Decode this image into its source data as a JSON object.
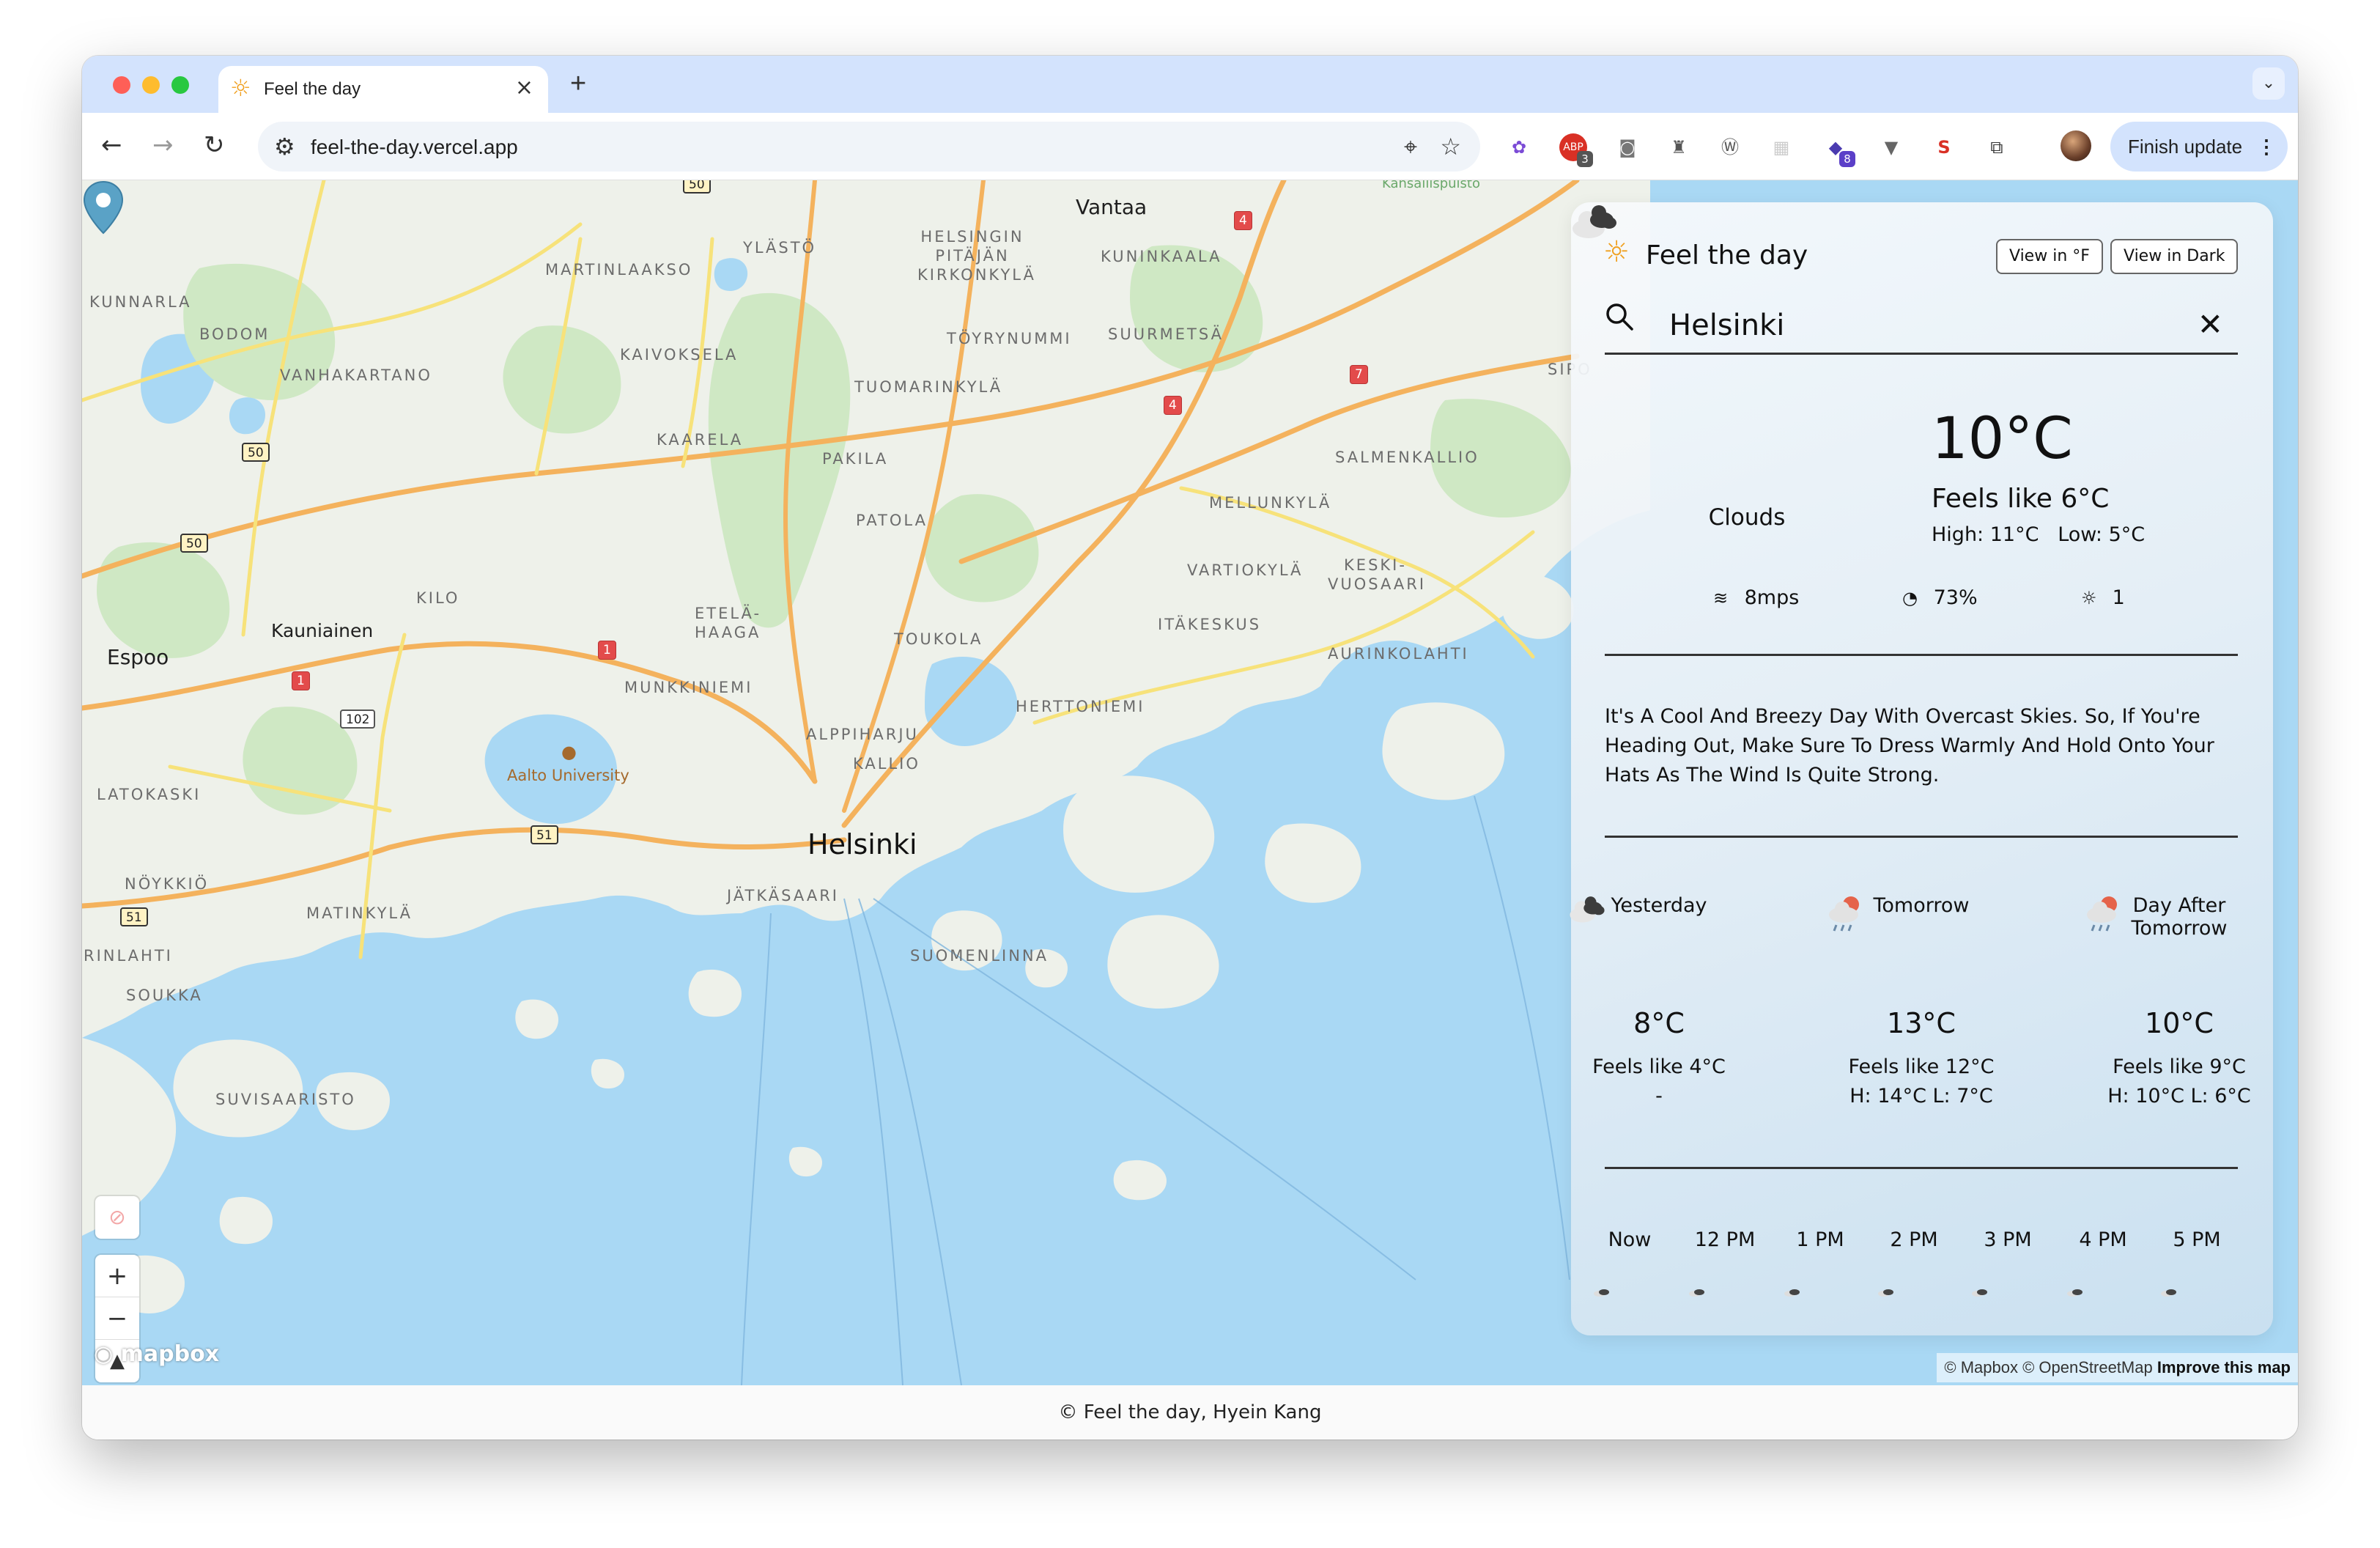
{
  "browser": {
    "tab_title": "Feel the day",
    "tab_icon": "sun-icon",
    "url": "feel-the-day.vercel.app",
    "extension_badges": [
      "3",
      "8"
    ],
    "finish_update_label": "Finish update"
  },
  "map": {
    "labels": {
      "vantaa": "Vantaa",
      "ylasto": "YLÄSTÖ",
      "helsingin_pitajan_kirkonkyla": "HELSINGIN PITÄJÄN KIRKONKYLÄ",
      "kuninkaala": "KUNINKAALA",
      "martinlaakso": "MARTINLAAKSO",
      "kunnarla": "KUNNARLA",
      "bodom": "BODOM",
      "vanhakartano": "VANHAKARTANO",
      "kaivoksela": "KAIVOKSELA",
      "toyrynummi": "TÖYRYNUMMI",
      "suurmetsa": "SUURMETSÄ",
      "tuomarinkyla": "TUOMARINKYLÄ",
      "kaarela": "KAARELA",
      "pakila": "PAKILA",
      "salmenkallio": "SALMENKALLIO",
      "mellunkyla": "MELLUNKYLÄ",
      "patola": "PATOLA",
      "vartiokyla": "VARTIOKYLÄ",
      "keski_vuosaari": "KESKI-VUOSAARI",
      "kilo": "KILO",
      "kauniainen": "Kauniainen",
      "espoo": "Espoo",
      "etela_haaga": "ETELÄ-HAAGA",
      "itakeskus": "ITÄKESKUS",
      "toukola": "TOUKOLA",
      "aurinkolahti": "AURINKOLAHTI",
      "munkkiniemi": "MUNKKINIEMI",
      "herttoniemi": "HERTTONIEMI",
      "alppiharju": "ALPPIHARJU",
      "kallio": "KALLIO",
      "aalto_university": "Aalto University",
      "latokaski": "LATOKASKI",
      "helsinki": "Helsinki",
      "noykkio": "NÖYKKIÖ",
      "jatkasaari": "JÄTKÄSAARI",
      "matinkyla": "MATINKYLÄ",
      "suomenlinna": "SUOMENLINNA",
      "rinlahti": "RINLAHTI",
      "soukka": "SOUKKA",
      "suvisaaristo": "SUVISAARISTO",
      "kansallispuisto": "Kansallispuisto",
      "sipoo": "SIPO"
    },
    "road_shields": {
      "r50a": "50",
      "r50b": "50",
      "r50c": "50",
      "r4a": "4",
      "r4b": "4",
      "r7": "7",
      "r1a": "1",
      "r1b": "1",
      "r102": "102",
      "r51a": "51",
      "r51b": "51"
    },
    "attribution": "© Mapbox © OpenStreetMap",
    "improve_link": "Improve this map",
    "logo": "mapbox",
    "controls": [
      "geolocate-off-icon",
      "zoom-in-icon",
      "zoom-out-icon",
      "compass-icon"
    ]
  },
  "panel": {
    "title": "Feel the day",
    "unit_toggle_label": "View in °F",
    "theme_toggle_label": "View in Dark",
    "search_value": "Helsinki",
    "current": {
      "condition": "Clouds",
      "icon": "clouds-icon",
      "temp": "10°C",
      "feels_like": "Feels like 6°C",
      "high": "High: 11°C",
      "low": "Low: 5°C",
      "wind": "8mps",
      "humidity": "73%",
      "uv": "1"
    },
    "summary": "It's A Cool And Breezy Day With Overcast Skies. So, If You're Heading Out, Make Sure To Dress Warmly And Hold Onto Your Hats As The Wind Is Quite Strong.",
    "forecast": [
      {
        "day": "Yesterday",
        "icon": "clouds-icon",
        "temp": "8°C",
        "feels": "Feels like 4°C",
        "hilo": "-"
      },
      {
        "day": "Tomorrow",
        "icon": "rain-icon",
        "temp": "13°C",
        "feels": "Feels like 12°C",
        "hilo": "H: 14°C L: 7°C"
      },
      {
        "day": "Day After Tomorrow",
        "icon": "rain-icon",
        "temp": "10°C",
        "feels": "Feels like 9°C",
        "hilo": "H: 10°C L: 6°C"
      }
    ],
    "hourly": [
      {
        "label": "Now"
      },
      {
        "label": "12 PM"
      },
      {
        "label": "1 PM"
      },
      {
        "label": "2 PM"
      },
      {
        "label": "3 PM"
      },
      {
        "label": "4 PM"
      },
      {
        "label": "5 PM"
      }
    ]
  },
  "footer": {
    "text": "© Feel the day, Hyein Kang"
  },
  "colors": {
    "water": "#a9d8f4",
    "land": "#eef1ea",
    "park": "#cfe8c4",
    "road_major": "#f4b25d",
    "road_secondary": "#f7e27a",
    "accent_sun": "#f0a020",
    "pin": "#5aa2c6"
  }
}
